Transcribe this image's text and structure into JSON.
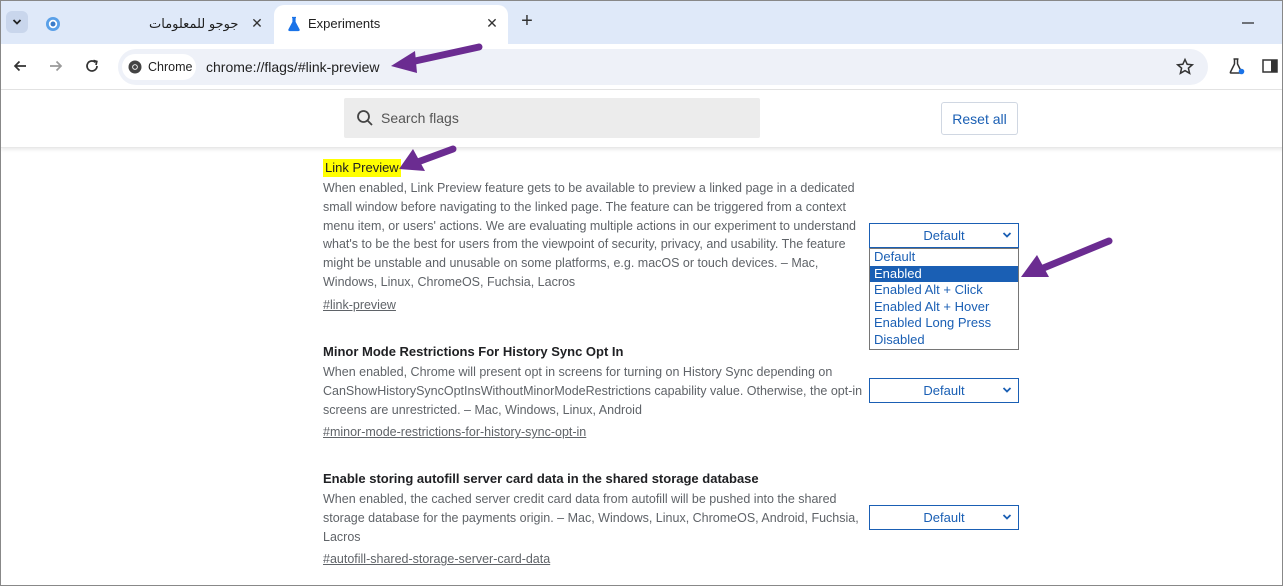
{
  "window": {
    "tabs": [
      {
        "title": "جوجو للمعلومات",
        "active": false
      },
      {
        "title": "Experiments",
        "active": true
      }
    ],
    "new_tab": "+"
  },
  "toolbar": {
    "chip_label": "Chrome",
    "url": "chrome://flags/#link-preview"
  },
  "flags_header": {
    "search_placeholder": "Search flags",
    "reset_label": "Reset all"
  },
  "flags": [
    {
      "title": "Link Preview",
      "description": "When enabled, Link Preview feature gets to be available to preview a linked page in a dedicated small window before navigating to the linked page. The feature can be triggered from a context menu item, or users' actions. We are evaluating multiple actions in our experiment to understand what's to be the best for users from the viewpoint of security, privacy, and usability. The feature might be unstable and unusable on some platforms, e.g. macOS or touch devices. – Mac, Windows, Linux, ChromeOS, Fuchsia, Lacros",
      "link": "#link-preview",
      "select_value": "Default"
    },
    {
      "title": "Minor Mode Restrictions For History Sync Opt In",
      "description": "When enabled, Chrome will present opt in screens for turning on History Sync depending on CanShowHistorySyncOptInsWithoutMinorModeRestrictions capability value. Otherwise, the opt-in screens are unrestricted. – Mac, Windows, Linux, Android",
      "link": "#minor-mode-restrictions-for-history-sync-opt-in",
      "select_value": "Default"
    },
    {
      "title": "Enable storing autofill server card data in the shared storage database",
      "description": "When enabled, the cached server credit card data from autofill will be pushed into the shared storage database for the payments origin. – Mac, Windows, Linux, ChromeOS, Android, Fuchsia, Lacros",
      "link": "#autofill-shared-storage-server-card-data",
      "select_value": "Default"
    }
  ],
  "dropdown_options": [
    "Default",
    "Enabled",
    "Enabled Alt + Click",
    "Enabled Alt + Hover",
    "Enabled Long Press",
    "Disabled"
  ],
  "dropdown_selected": "Enabled",
  "colors": {
    "accent": "#1a5fb4",
    "highlight": "#ffff00",
    "annotation_arrow": "#6b2c91",
    "tabstrip": "#dfe9f9"
  }
}
